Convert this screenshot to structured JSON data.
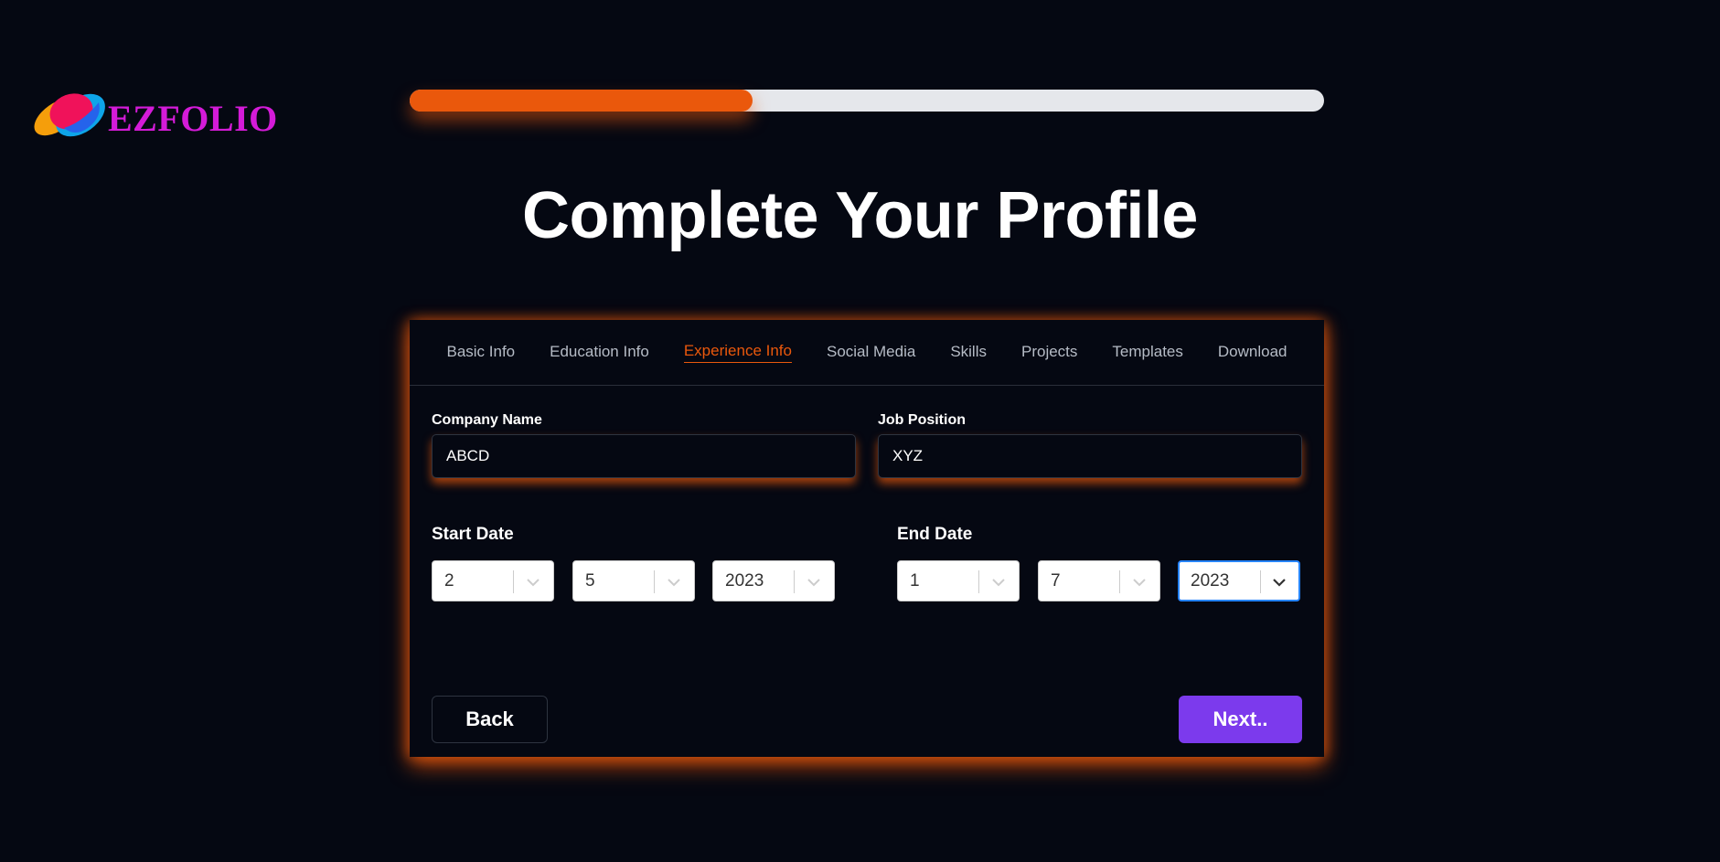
{
  "brand": {
    "name": "EZFOLIO",
    "color": "#d41bd8"
  },
  "progress": {
    "value_percent": 37.5,
    "fill_color": "#ea580c"
  },
  "title": "Complete Your Profile",
  "tabs": [
    {
      "label": "Basic Info",
      "active": false
    },
    {
      "label": "Education Info",
      "active": false
    },
    {
      "label": "Experience Info",
      "active": true
    },
    {
      "label": "Social Media",
      "active": false
    },
    {
      "label": "Skills",
      "active": false
    },
    {
      "label": "Projects",
      "active": false
    },
    {
      "label": "Templates",
      "active": false
    },
    {
      "label": "Download",
      "active": false
    }
  ],
  "form": {
    "company_name": {
      "label": "Company Name",
      "value": "ABCD"
    },
    "job_position": {
      "label": "Job Position",
      "value": "XYZ"
    },
    "start_date": {
      "label": "Start Date",
      "day": "2",
      "month": "5",
      "year": "2023"
    },
    "end_date": {
      "label": "End Date",
      "day": "1",
      "month": "7",
      "year": "2023"
    }
  },
  "buttons": {
    "back": "Back",
    "next": "Next.."
  },
  "colors": {
    "accent": "#ea580c",
    "primary_button": "#7c3aed",
    "background": "#050812",
    "focus": "#2684ff"
  }
}
